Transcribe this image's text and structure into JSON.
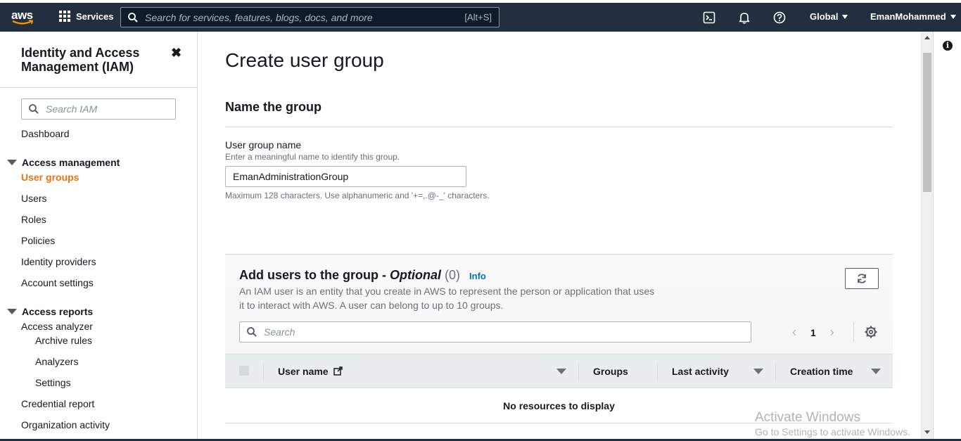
{
  "topnav": {
    "logo_text": "aws",
    "services_label": "Services",
    "search_placeholder": "Search for services, features, blogs, docs, and more",
    "search_shortcut": "[Alt+S]",
    "region_label": "Global",
    "user_label": "EmanMohammed"
  },
  "sidebar": {
    "title": "Identity and Access Management (IAM)",
    "close_glyph": "✖",
    "search_placeholder": "Search IAM",
    "dashboard": "Dashboard",
    "access_management": {
      "label": "Access management",
      "items": [
        "User groups",
        "Users",
        "Roles",
        "Policies",
        "Identity providers",
        "Account settings"
      ],
      "active": "User groups"
    },
    "access_reports": {
      "label": "Access reports",
      "access_analyzer": "Access analyzer",
      "analyzer_items": [
        "Archive rules",
        "Analyzers",
        "Settings"
      ],
      "items": [
        "Credential report",
        "Organization activity"
      ]
    }
  },
  "main": {
    "page_title": "Create user group",
    "section_title": "Name the group",
    "field_label": "User group name",
    "field_description": "Enter a meaningful name to identify this group.",
    "field_value": "EmanAdministrationGroup",
    "field_constraint": "Maximum 128 characters. Use alphanumeric and '+=,.@-_' characters."
  },
  "users_panel": {
    "title_prefix": "Add users to the group - ",
    "title_optional": "Optional",
    "count": "(0)",
    "info_link": "Info",
    "description": "An IAM user is an entity that you create in AWS to represent the person or application that uses it to interact with AWS. A user can belong to up to 10 groups.",
    "search_placeholder": "Search",
    "page_number": "1",
    "columns": [
      "User name",
      "Groups",
      "Last activity",
      "Creation time"
    ],
    "empty_message": "No resources to display"
  },
  "watermark": {
    "title": "Activate Windows",
    "subtitle": "Go to Settings to activate Windows."
  },
  "rail": {
    "info_glyph": "i"
  },
  "colors": {
    "nav_bg": "#232f3e",
    "active_link": "#ec7211",
    "info_link": "#0073bb"
  }
}
